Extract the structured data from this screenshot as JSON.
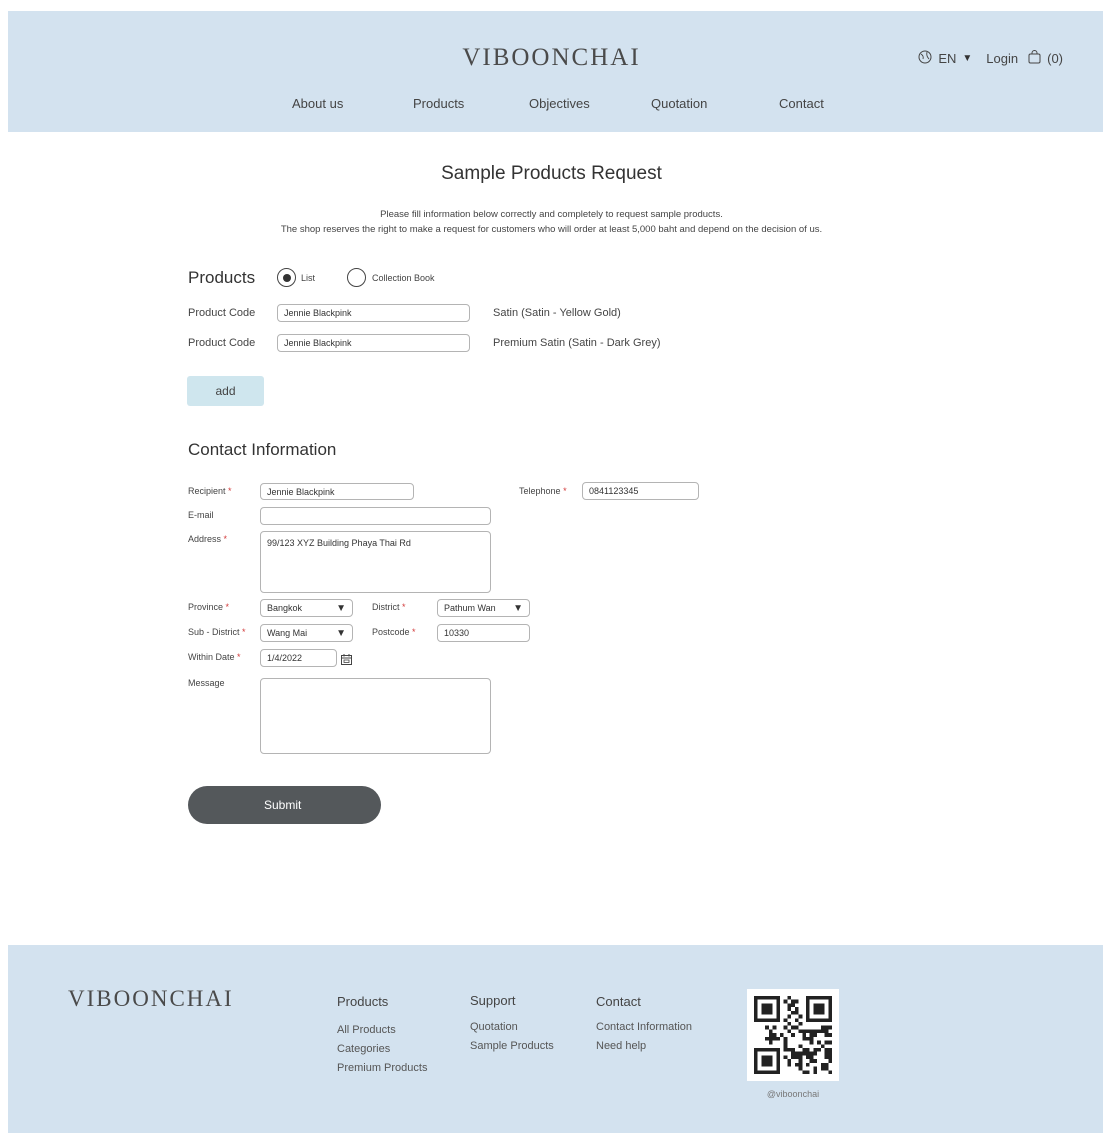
{
  "header": {
    "brand": "VIBOONCHAI",
    "lang": "EN",
    "lang_arrow": "▼",
    "login": "Login",
    "cart": "(0)",
    "nav": [
      "About us",
      "Products",
      "Objectives",
      "Quotation",
      "Contact"
    ]
  },
  "page": {
    "title": "Sample Products Request",
    "intro_line1": "Please fill information below correctly and completely to request sample products.",
    "intro_line2": "The shop reserves the right to make a request for customers who will order at least 5,000 baht and depend on the decision of us."
  },
  "products": {
    "heading": "Products",
    "options": [
      {
        "label": "List",
        "selected": true
      },
      {
        "label": "Collection Book",
        "selected": false
      }
    ],
    "rows": [
      {
        "label": "Product Code",
        "value": "Jennie Blackpink",
        "description": "Satin (Satin - Yellow Gold)"
      },
      {
        "label": "Product Code",
        "value": "Jennie Blackpink",
        "description": "Premium Satin (Satin - Dark Grey)"
      }
    ],
    "add_label": "add"
  },
  "contact": {
    "heading": "Contact Information",
    "recipient_label": "Recipient",
    "recipient_value": "Jennie Blackpink",
    "telephone_label": "Telephone",
    "telephone_value": "0841123345",
    "email_label": "E-mail",
    "email_value": "",
    "address_label": "Address",
    "address_value": "99/123 XYZ Building Phaya Thai Rd",
    "province_label": "Province",
    "province_value": "Bangkok",
    "district_label": "District",
    "district_value": "Pathum Wan",
    "subdistrict_label": "Sub - District",
    "subdistrict_value": "Wang Mai",
    "postcode_label": "Postcode",
    "postcode_value": "10330",
    "within_date_label": "Within Date",
    "within_date_value": "1/4/2022",
    "message_label": "Message",
    "message_value": "",
    "required_mark": "*",
    "select_arrow": "▼"
  },
  "submit_label": "Submit",
  "footer": {
    "brand": "VIBOONCHAI",
    "columns": [
      {
        "heading": "Products",
        "links": [
          "All Products",
          "Categories",
          "Premium Products"
        ]
      },
      {
        "heading": "Support",
        "links": [
          "Quotation",
          "Sample Products"
        ]
      },
      {
        "heading": "Contact",
        "links": [
          "Contact Information",
          "Need help"
        ]
      }
    ],
    "qr_handle": "@viboonchai"
  },
  "colors": {
    "header_bg": "#d3e2ef",
    "add_button": "#cfe6ee",
    "submit_button": "#54585b",
    "required": "#d23a3a"
  }
}
